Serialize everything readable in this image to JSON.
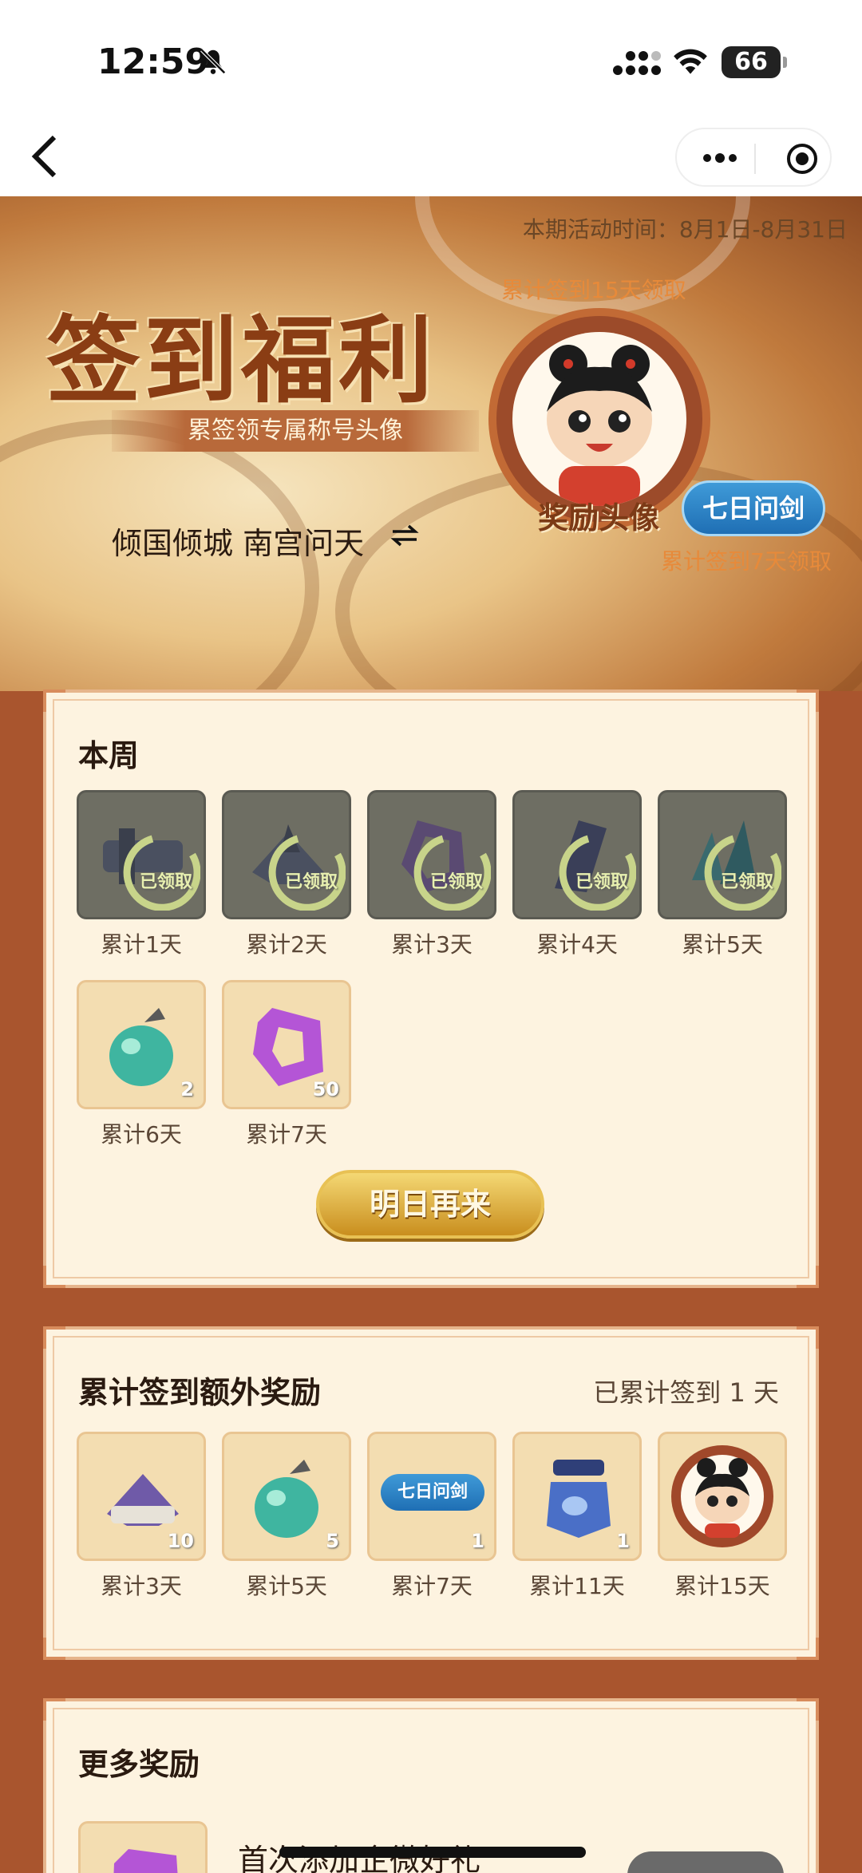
{
  "status": {
    "time": "12:59",
    "battery": "66"
  },
  "banner": {
    "period": "本期活动时间：8月1日-8月31日",
    "title": "签到福利",
    "subtitle": "累签领专属称号头像",
    "user": "倾国倾城 南宫问天",
    "avatar_note": "累计签到15天领取",
    "reward_label": "奖励头像",
    "badge": "七日问剑",
    "badge_note": "累计签到7天领取"
  },
  "week": {
    "title": "本周",
    "claimed_label": "已领取",
    "items": [
      {
        "label": "累计1天",
        "claimed": true,
        "icon": "scroll-item-icon"
      },
      {
        "label": "累计2天",
        "claimed": true,
        "icon": "crystal-scroll-icon"
      },
      {
        "label": "累计3天",
        "claimed": true,
        "icon": "jade-token-icon"
      },
      {
        "label": "累计4天",
        "claimed": true,
        "icon": "dark-crystal-icon"
      },
      {
        "label": "累计5天",
        "claimed": true,
        "icon": "teal-crystal-icon"
      },
      {
        "label": "累计6天",
        "claimed": false,
        "icon": "green-fruit-icon",
        "count": "2"
      },
      {
        "label": "累计7天",
        "claimed": false,
        "icon": "purple-token-icon",
        "count": "50"
      }
    ],
    "button": "明日再来"
  },
  "extra": {
    "title": "累计签到额外奖励",
    "progress": "已累计签到 1 天",
    "items": [
      {
        "label": "累计3天",
        "icon": "crystal-scroll-icon",
        "count": "10"
      },
      {
        "label": "累计5天",
        "icon": "green-fruit-icon",
        "count": "5"
      },
      {
        "label": "累计7天",
        "icon": "title-badge-icon",
        "badge": "七日问剑",
        "count": "1"
      },
      {
        "label": "累计11天",
        "icon": "blue-gem-icon",
        "count": "1"
      },
      {
        "label": "累计15天",
        "icon": "avatar-frame-icon"
      }
    ]
  },
  "more": {
    "title": "更多奖励",
    "first_item": "首次添加企微好礼"
  }
}
